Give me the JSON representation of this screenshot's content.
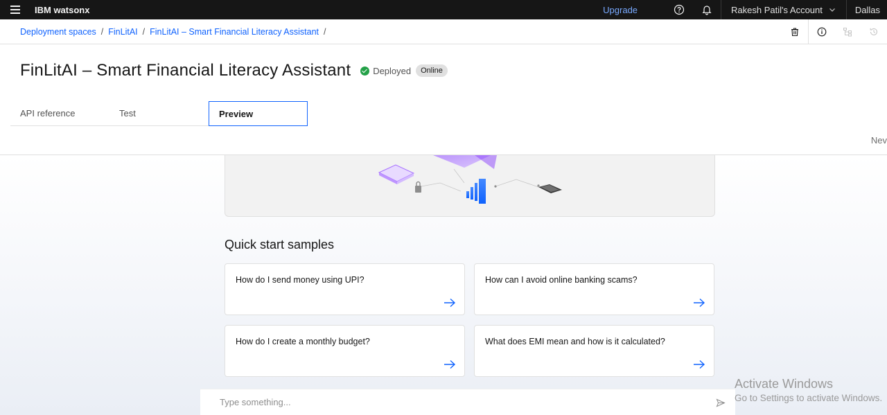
{
  "header": {
    "brand": "IBM watsonx",
    "upgrade": "Upgrade",
    "account": "Rakesh Patil's Account",
    "region": "Dallas",
    "icons": [
      "menu-icon",
      "help-icon",
      "notification-icon",
      "chevron-down-icon"
    ]
  },
  "breadcrumb": {
    "items": [
      "Deployment spaces",
      "FinLitAI",
      "FinLitAI – Smart Financial Literacy Assistant"
    ],
    "separator": "/",
    "actions": [
      "delete-icon",
      "info-icon",
      "hierarchy-icon",
      "history-icon"
    ]
  },
  "page": {
    "title": "FinLitAI – Smart Financial Literacy Assistant",
    "status": "Deployed",
    "tag": "Online",
    "status_color": "#24a148"
  },
  "tabs": [
    {
      "label": "API reference",
      "active": false
    },
    {
      "label": "Test",
      "active": false
    },
    {
      "label": "Preview",
      "active": true
    }
  ],
  "side_text": "Nev",
  "quick_start": {
    "title": "Quick start samples",
    "samples": [
      "How do I send money using UPI?",
      "How can I avoid online banking scams?",
      "How do I create a monthly budget?",
      "What does EMI mean and how is it calculated?"
    ]
  },
  "chat_input": {
    "placeholder": "Type something..."
  },
  "watermark": {
    "line1": "Activate Windows",
    "line2": "Go to Settings to activate Windows."
  },
  "colors": {
    "accent": "#0f62fe",
    "header_bg": "#161616"
  }
}
